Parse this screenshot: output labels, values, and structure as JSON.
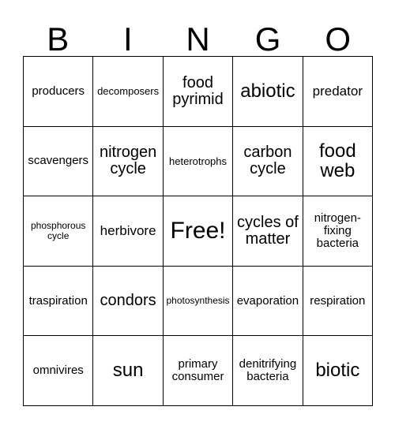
{
  "card": {
    "header_letters": [
      "B",
      "I",
      "N",
      "G",
      "O"
    ],
    "rows": [
      [
        {
          "text": "producers",
          "size": "m"
        },
        {
          "text": "decomposers",
          "size": "s"
        },
        {
          "text": "food pyrimid",
          "size": "xl"
        },
        {
          "text": "abiotic",
          "size": "xxl"
        },
        {
          "text": "predator",
          "size": "l"
        }
      ],
      [
        {
          "text": "scavengers",
          "size": "m"
        },
        {
          "text": "nitrogen cycle",
          "size": "xl"
        },
        {
          "text": "heterotrophs",
          "size": "s"
        },
        {
          "text": "carbon cycle",
          "size": "xl"
        },
        {
          "text": "food web",
          "size": "xxl"
        }
      ],
      [
        {
          "text": "phosphorous cycle",
          "size": "xs"
        },
        {
          "text": "herbivore",
          "size": "l"
        },
        {
          "text": "Free!",
          "size": "free"
        },
        {
          "text": "cycles of matter",
          "size": "xl"
        },
        {
          "text": "nitrogen-fixing bacteria",
          "size": "m"
        }
      ],
      [
        {
          "text": "traspiration",
          "size": "m"
        },
        {
          "text": "condors",
          "size": "xl"
        },
        {
          "text": "photosynthesis",
          "size": "xs"
        },
        {
          "text": "evaporation",
          "size": "m"
        },
        {
          "text": "respiration",
          "size": "m"
        }
      ],
      [
        {
          "text": "omnivires",
          "size": "m"
        },
        {
          "text": "sun",
          "size": "xxl"
        },
        {
          "text": "primary consumer",
          "size": "m"
        },
        {
          "text": "denitrifying bacteria",
          "size": "m"
        },
        {
          "text": "biotic",
          "size": "xxl"
        }
      ]
    ],
    "free_space": {
      "row": 2,
      "col": 2
    },
    "colors": {
      "background": "#ffffff",
      "text": "#000000",
      "border": "#000000"
    }
  }
}
